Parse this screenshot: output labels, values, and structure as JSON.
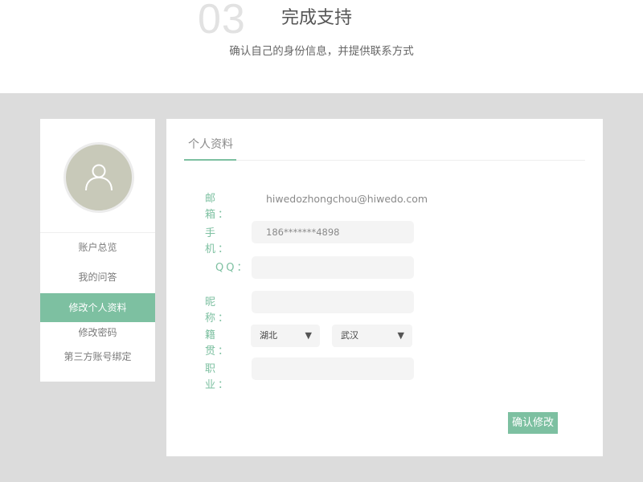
{
  "header": {
    "step_number": "03",
    "step_title": "完成支持",
    "step_subtitle": "确认自己的身份信息，并提供联系方式"
  },
  "sidebar": {
    "avatar_icon": "user-icon",
    "items": [
      {
        "label": "账户总览",
        "active": false
      },
      {
        "label": "我的问答",
        "active": false
      },
      {
        "label": "修改个人资料",
        "active": true
      },
      {
        "label": "修改密码",
        "active": false
      },
      {
        "label": "第三方账号绑定",
        "active": false
      }
    ]
  },
  "main": {
    "tab_label": "个人资料",
    "form": {
      "email_label": "邮 箱：",
      "email_value": "hiwedozhongchou@hiwedo.com",
      "phone_label": "手 机：",
      "phone_value": "186*******4898",
      "qq_label": "QQ：",
      "qq_value": "",
      "nickname_label": "昵 称：",
      "nickname_value": "",
      "hometown_label": "籍 贯：",
      "province_value": "湖北",
      "city_value": "武汉",
      "occupation_label": "职 业：",
      "occupation_value": ""
    },
    "confirm_button_label": "确认修改"
  },
  "colors": {
    "accent": "#7dc0a1",
    "background_gray": "#dcdcdc",
    "input_bg": "#f4f4f4"
  }
}
